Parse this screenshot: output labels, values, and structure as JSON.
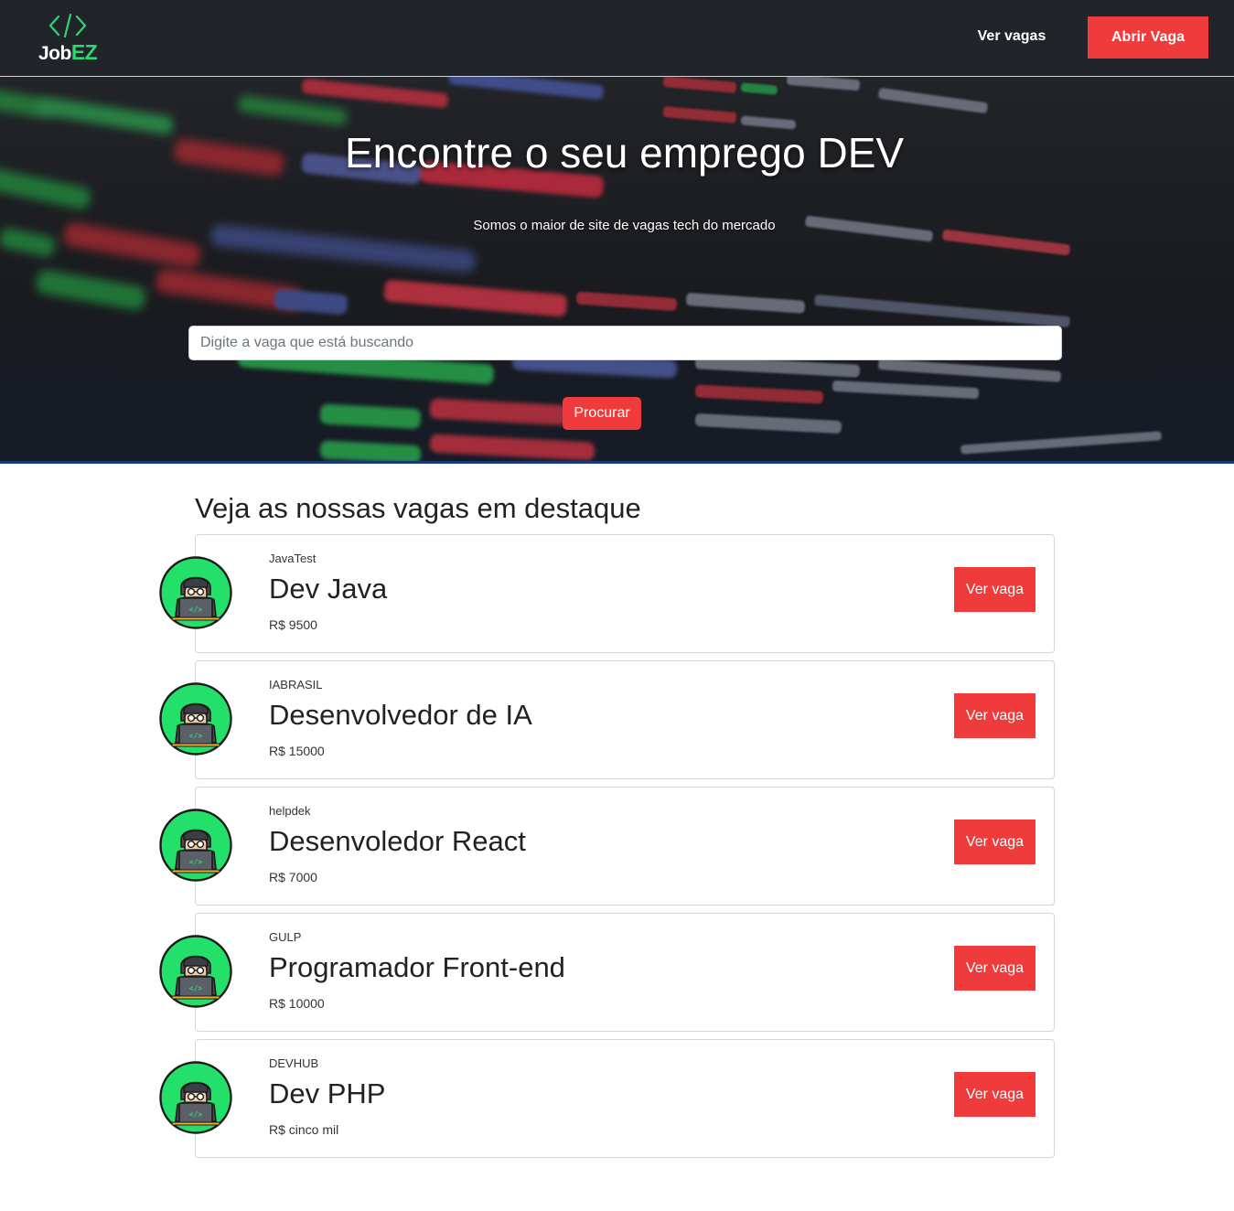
{
  "brand": {
    "logo_part1": "Job",
    "logo_part2": "EZ",
    "icon": "code-brackets-icon",
    "accent_color": "#2ed573"
  },
  "navbar": {
    "link_label": "Ver vagas",
    "cta_label": "Abrir Vaga",
    "background": "#212529",
    "cta_color": "#ef3b3b"
  },
  "hero": {
    "title": "Encontre o seu emprego DEV",
    "subtitle": "Somos o maior de site de vagas tech do mercado",
    "search_placeholder": "Digite a vaga que está buscando",
    "search_value": "",
    "search_button": "Procurar",
    "background_image": "blurred-code-screen"
  },
  "featured": {
    "heading": "Veja as nossas vagas em destaque",
    "avatar_icon": "developer-avatar-icon",
    "jobs": [
      {
        "company": "JavaTest",
        "title": "Dev Java",
        "salary": "R$ 9500",
        "button": "Ver vaga"
      },
      {
        "company": "IABRASIL",
        "title": "Desenvolvedor de IA",
        "salary": "R$ 15000",
        "button": "Ver vaga"
      },
      {
        "company": "helpdek",
        "title": "Desenvoledor React",
        "salary": "R$ 7000",
        "button": "Ver vaga"
      },
      {
        "company": "GULP",
        "title": "Programador Front-end",
        "salary": "R$ 10000",
        "button": "Ver vaga"
      },
      {
        "company": "DEVHUB",
        "title": "Dev PHP",
        "salary": "R$ cinco mil",
        "button": "Ver vaga"
      }
    ]
  }
}
